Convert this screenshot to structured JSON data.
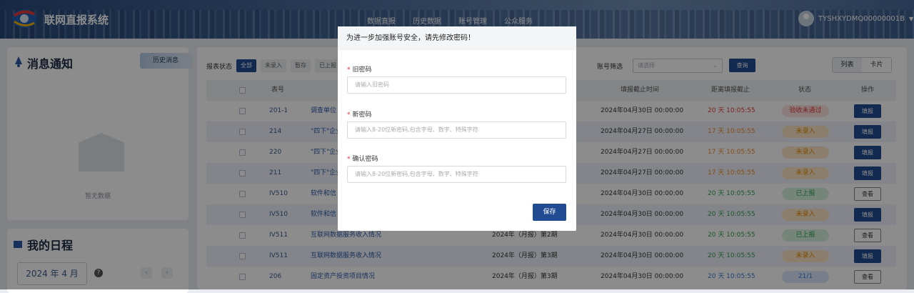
{
  "header": {
    "brand": "联网直报系统",
    "nav": [
      "数据直报",
      "历史数据",
      "账号管理",
      "公众服务"
    ],
    "user": "TYSHXYDMQ00000001B"
  },
  "notice": {
    "title": "消息通知",
    "history": "历史消息",
    "empty": "暂无数据"
  },
  "schedule": {
    "title": "我的日程",
    "month": "2024 年 4 月"
  },
  "filter": {
    "label": "报表状态",
    "chips": [
      "全部",
      "未录入",
      "暂存",
      "已上报"
    ],
    "account_label": "账号筛选",
    "account_placeholder": "请选择",
    "query": "查询"
  },
  "view_toggle": {
    "list": "列表",
    "card": "卡片"
  },
  "table": {
    "headers": {
      "no": "表号",
      "remaining": "距离填报截止",
      "status": "状态",
      "op": "操作",
      "deadline_col": "填报截止时间"
    },
    "rows": [
      {
        "no": "201-1",
        "name": "调查单位",
        "period": "",
        "deadline": "2024年04月30日 00:00:00",
        "remaining": "20 天 10:05:55",
        "remaining_color": "#e53935",
        "status": "验收未通过",
        "status_bg": "#fde2e2",
        "status_fg": "#e53935",
        "action": "填报",
        "action_type": "primary"
      },
      {
        "no": "214",
        "name": "\"四下\"企业",
        "period": "",
        "deadline": "2024年04月27日 00:00:00",
        "remaining": "17 天 10:05:55",
        "remaining_color": "#f08a24",
        "status": "未录入",
        "status_bg": "#fde6c6",
        "status_fg": "#e68a00",
        "action": "填报",
        "action_type": "primary"
      },
      {
        "no": "220",
        "name": "\"四下\"企业",
        "period": "",
        "deadline": "2024年04月27日 00:00:00",
        "remaining": "17 天 10:05:55",
        "remaining_color": "#f08a24",
        "status": "未录入",
        "status_bg": "#fde6c6",
        "status_fg": "#e68a00",
        "action": "填报",
        "action_type": "primary"
      },
      {
        "no": "211",
        "name": "\"四下\"企业",
        "period": "",
        "deadline": "2024年04月27日 00:00:00",
        "remaining": "17 天 10:05:55",
        "remaining_color": "#f08a24",
        "status": "未录入",
        "status_bg": "#fde6c6",
        "status_fg": "#e68a00",
        "action": "填报",
        "action_type": "primary"
      },
      {
        "no": "IV510",
        "name": "软件和信",
        "period": "",
        "deadline": "2024年04月30日 00:00:00",
        "remaining": "20 天 10:05:55",
        "remaining_color": "#2e9e4f",
        "status": "已上报",
        "status_bg": "#d8f2de",
        "status_fg": "#2e9e4f",
        "action": "查看",
        "action_type": "outline"
      },
      {
        "no": "IV510",
        "name": "软件和信",
        "period": "",
        "deadline": "2024年04月30日 00:00:00",
        "remaining": "20 天 10:05:55",
        "remaining_color": "#2e9e4f",
        "status": "未录入",
        "status_bg": "#fde6c6",
        "status_fg": "#e68a00",
        "action": "填报",
        "action_type": "primary"
      },
      {
        "no": "IV511",
        "name": "互联网数据服务收入情况",
        "period": "2024年（月报）第2期",
        "deadline": "2024年04月30日 00:00:00",
        "remaining": "20 天 10:05:55",
        "remaining_color": "#2e9e4f",
        "status": "已上报",
        "status_bg": "#d8f2de",
        "status_fg": "#2e9e4f",
        "action": "查看",
        "action_type": "outline"
      },
      {
        "no": "IV511",
        "name": "互联网数据服务收入情况",
        "period": "2024年（月报）第3期",
        "deadline": "2024年04月30日 00:00:00",
        "remaining": "20 天 10:05:55",
        "remaining_color": "#2e9e4f",
        "status": "未录入",
        "status_bg": "#fde6c6",
        "status_fg": "#e68a00",
        "action": "填报",
        "action_type": "primary"
      },
      {
        "no": "206",
        "name": "固定资产投资项目情况",
        "period": "2024年（月报）第3期",
        "deadline": "2024年04月30日 00:00:00",
        "remaining": "20 天 10:05:55",
        "remaining_color": "#3a7bd5",
        "status": "21/1",
        "status_bg": "#dbe8fb",
        "status_fg": "#3a7bd5",
        "action": "查看",
        "action_type": "outline"
      }
    ]
  },
  "modal": {
    "title": "为进一步加强账号安全，请先修改密码！",
    "old_label": "旧密码",
    "old_placeholder": "请输入旧密码",
    "new_label": "新密码",
    "new_placeholder": "请输入8-20位新密码,包含字母、数字、特殊字符",
    "confirm_label": "确认密码",
    "confirm_placeholder": "请输入8-20位新密码,包含字母、数字、特殊字符",
    "required_mark": "*",
    "save": "保存"
  }
}
